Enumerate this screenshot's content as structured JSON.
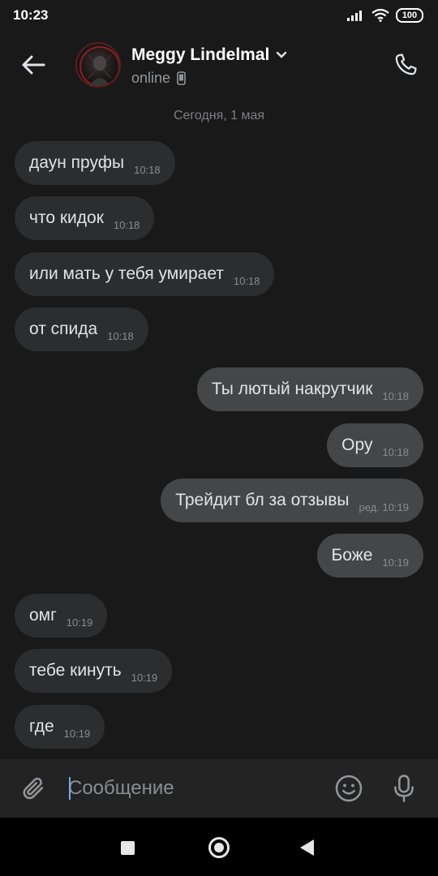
{
  "status_bar": {
    "time": "10:23",
    "battery": "100"
  },
  "header": {
    "name": "Meggy Lindelmal",
    "status": "online",
    "colors": {
      "name": "#ffffff",
      "status": "#939699"
    }
  },
  "chat": {
    "date_separator": "Сегодня, 1 мая",
    "messages": [
      {
        "direction": "in",
        "text": "даун пруфы",
        "time": "10:18"
      },
      {
        "direction": "in",
        "text": "что кидок",
        "time": "10:18"
      },
      {
        "direction": "in",
        "text": "или мать у тебя умирает",
        "time": "10:18"
      },
      {
        "direction": "in",
        "text": "от спида",
        "time": "10:18"
      },
      {
        "direction": "out",
        "text": "Ты лютый накрутчик",
        "time": "10:18"
      },
      {
        "direction": "out",
        "text": "Ору",
        "time": "10:18"
      },
      {
        "direction": "out",
        "text": "Трейдит бл за отзывы",
        "time": "ред. 10:19"
      },
      {
        "direction": "out",
        "text": "Боже",
        "time": "10:19"
      },
      {
        "direction": "in",
        "text": "омг",
        "time": "10:19"
      },
      {
        "direction": "in",
        "text": "тебе кинуть",
        "time": "10:19"
      },
      {
        "direction": "in",
        "text": "где",
        "time": "10:19"
      }
    ]
  },
  "composer": {
    "placeholder": "Сообщение",
    "value": ""
  },
  "icons": {
    "back": "arrow-left-icon",
    "call": "phone-icon",
    "attach": "paperclip-icon",
    "emoji": "smile-icon",
    "mic": "microphone-icon",
    "device": "mobile-phone-icon"
  },
  "colors": {
    "background": "#19191a",
    "incoming_bubble": "#2c2d2e",
    "outgoing_bubble": "#454647",
    "accent": "#71aaeb"
  }
}
